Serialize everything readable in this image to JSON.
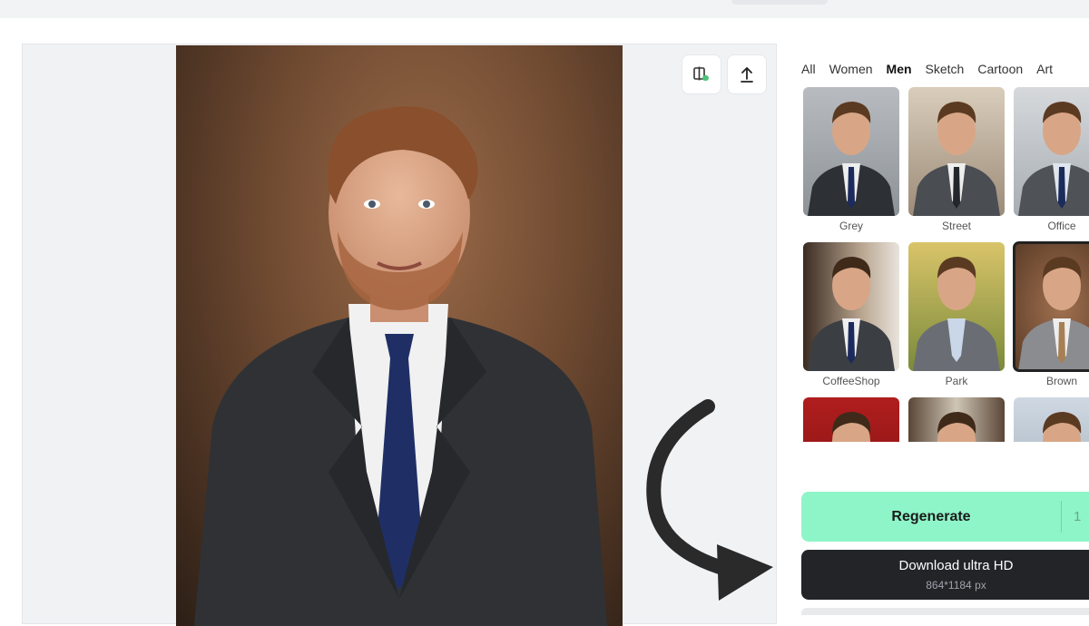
{
  "tools": {
    "compare_icon": "compare-icon",
    "upload_icon": "upload-icon"
  },
  "style_tabs": [
    {
      "label": "All",
      "active": false
    },
    {
      "label": "Women",
      "active": false
    },
    {
      "label": "Men",
      "active": true
    },
    {
      "label": "Sketch",
      "active": false
    },
    {
      "label": "Cartoon",
      "active": false
    },
    {
      "label": "Art",
      "active": false
    }
  ],
  "styles": [
    {
      "label": "Grey",
      "selected": false
    },
    {
      "label": "Street",
      "selected": false
    },
    {
      "label": "Office",
      "selected": false
    },
    {
      "label": "CoffeeShop",
      "selected": false
    },
    {
      "label": "Park",
      "selected": false
    },
    {
      "label": "Brown",
      "selected": true
    }
  ],
  "actions": {
    "regenerate_label": "Regenerate",
    "regenerate_cost": "1",
    "download_label": "Download ultra HD",
    "download_resolution": "864*1184 px"
  },
  "colors": {
    "accent": "#8ef5c8",
    "dark_button": "#222428"
  }
}
